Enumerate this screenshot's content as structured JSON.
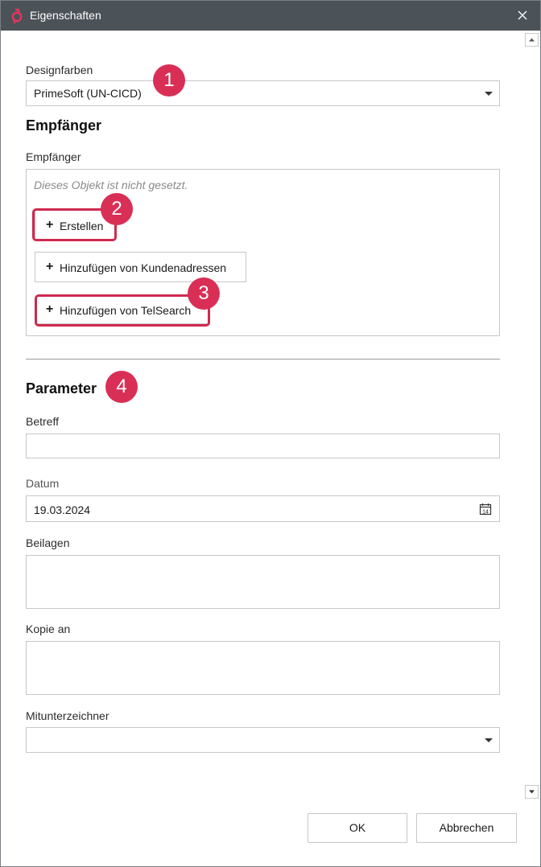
{
  "window": {
    "title": "Eigenschaften"
  },
  "design": {
    "label": "Designfarben",
    "value": "PrimeSoft (UN-CICD)"
  },
  "recipients": {
    "heading": "Empfänger",
    "label": "Empfänger",
    "placeholder": "Dieses Objekt ist nicht gesetzt.",
    "buttons": {
      "create": "Erstellen",
      "add_customer": "Hinzufügen von Kundenadressen",
      "add_telsearch": "Hinzufügen von TelSearch"
    }
  },
  "parameters": {
    "heading": "Parameter",
    "subject": {
      "label": "Betreff",
      "value": ""
    },
    "date": {
      "label": "Datum",
      "value": "19.03.2024",
      "icon_day": "14"
    },
    "attachments": {
      "label": "Beilagen",
      "value": ""
    },
    "copy_to": {
      "label": "Kopie an",
      "value": ""
    },
    "cosigner": {
      "label": "Mitunterzeichner",
      "value": ""
    }
  },
  "annotations": [
    "1",
    "2",
    "3",
    "4"
  ],
  "footer": {
    "ok": "OK",
    "cancel": "Abbrechen"
  },
  "colors": {
    "titlebar": "#4b5258",
    "accent": "#d92f56"
  }
}
